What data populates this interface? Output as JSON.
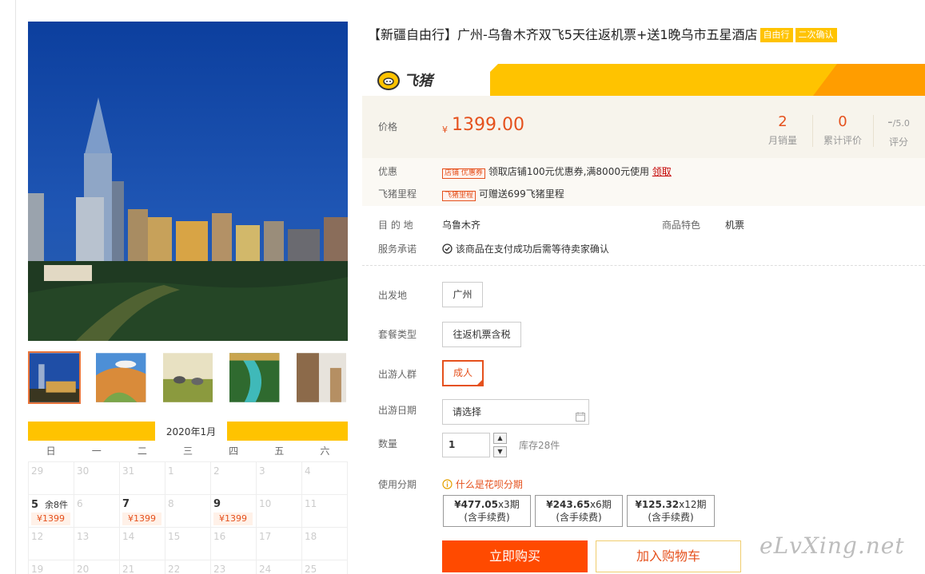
{
  "product": {
    "title": "【新疆自由行】广州-乌鲁木齐双飞5天往返机票+送1晚乌市五星酒店",
    "tags": [
      "自由行",
      "二次确认"
    ]
  },
  "brand": {
    "logo_text": "飞猪"
  },
  "price": {
    "label": "价格",
    "symbol": "¥",
    "value": "1399.00"
  },
  "stats": [
    {
      "value": "2",
      "caption": "月销量"
    },
    {
      "value": "0",
      "caption": "累计评价"
    },
    {
      "value": "-",
      "suffix": "/5.0",
      "caption": "评分"
    }
  ],
  "promotions": {
    "discount_label": "优惠",
    "discount_badge": "店铺 优惠券",
    "discount_text": "领取店铺100元优惠券,满8000元使用",
    "discount_link": "领取",
    "mileage_label": "飞猪里程",
    "mileage_badge": "飞猪里程",
    "mileage_text": "可赠送699飞猪里程"
  },
  "info": {
    "destination_label": "目 的 地",
    "destination": "乌鲁木齐",
    "feature_label": "商品特色",
    "feature": "机票",
    "service_label": "服务承诺",
    "service_text": "该商品在支付成功后需等待卖家确认"
  },
  "options": {
    "departure_label": "出发地",
    "departure": "广州",
    "package_label": "套餐类型",
    "package": "往返机票含税",
    "traveler_label": "出游人群",
    "traveler": "成人",
    "date_label": "出游日期",
    "date_placeholder": "请选择",
    "qty_label": "数量",
    "qty_value": "1",
    "stock_text": "库存28件",
    "installment_label": "使用分期",
    "installment_help": "什么是花呗分期"
  },
  "installments": [
    {
      "amount": "¥477.05",
      "periods": "x3期",
      "note": "(含手续费)"
    },
    {
      "amount": "¥243.65",
      "periods": "x6期",
      "note": "(含手续费)"
    },
    {
      "amount": "¥125.32",
      "periods": "x12期",
      "note": "(含手续费)"
    }
  ],
  "actions": {
    "buy": "立即购买",
    "cart": "加入购物车"
  },
  "calendar": {
    "month": "2020年1月",
    "weekdays": [
      "日",
      "一",
      "二",
      "三",
      "四",
      "五",
      "六"
    ],
    "days": [
      {
        "d": "29"
      },
      {
        "d": "30"
      },
      {
        "d": "31"
      },
      {
        "d": "1"
      },
      {
        "d": "2"
      },
      {
        "d": "3"
      },
      {
        "d": "4"
      },
      {
        "d": "5",
        "stock": "余8件",
        "price": "¥1399",
        "avail": true
      },
      {
        "d": "6"
      },
      {
        "d": "7",
        "price": "¥1399",
        "avail": true
      },
      {
        "d": "8"
      },
      {
        "d": "9",
        "price": "¥1399",
        "avail": true
      },
      {
        "d": "10"
      },
      {
        "d": "11"
      },
      {
        "d": "12"
      },
      {
        "d": "13"
      },
      {
        "d": "14"
      },
      {
        "d": "15"
      },
      {
        "d": "16"
      },
      {
        "d": "17"
      },
      {
        "d": "18"
      },
      {
        "d": "19"
      },
      {
        "d": "20"
      },
      {
        "d": "21"
      },
      {
        "d": "22"
      },
      {
        "d": "23"
      },
      {
        "d": "24"
      },
      {
        "d": "25"
      }
    ]
  },
  "watermark": "eLvXing.net"
}
